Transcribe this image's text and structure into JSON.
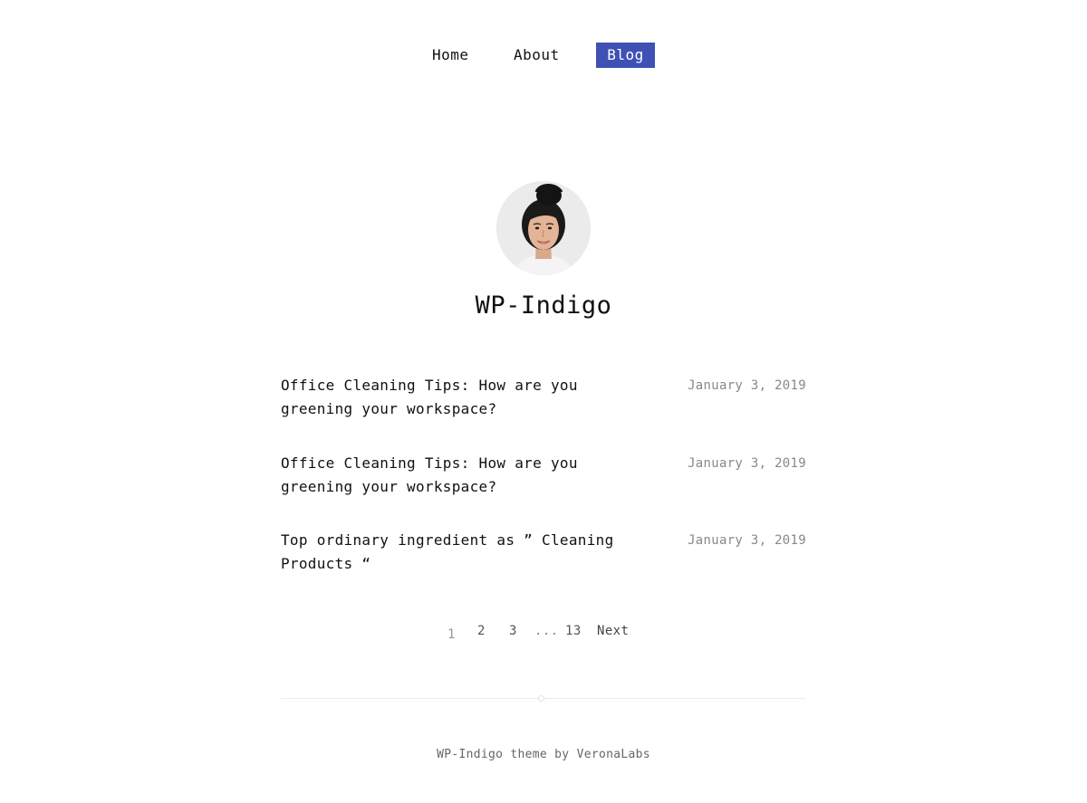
{
  "nav": {
    "items": [
      {
        "label": "Home"
      },
      {
        "label": "About"
      },
      {
        "label": "Blog",
        "active": true
      }
    ],
    "active_color": "#3f51b5"
  },
  "profile": {
    "avatar_icon": "profile-photo",
    "site_title": "WP-Indigo"
  },
  "posts": [
    {
      "title": "Office Cleaning Tips: How are you greening your workspace?",
      "date": "January 3, 2019"
    },
    {
      "title": "Office Cleaning Tips: How are you greening your workspace?",
      "date": "January 3, 2019"
    },
    {
      "title": "Top ordinary ingredient as ” Cleaning Products “",
      "date": "January 3, 2019"
    }
  ],
  "pagination": {
    "current": "1",
    "pages": [
      "2",
      "3"
    ],
    "dots": "...",
    "last": "13",
    "next": "Next"
  },
  "footer": {
    "text": "WP-Indigo theme by VeronaLabs"
  }
}
